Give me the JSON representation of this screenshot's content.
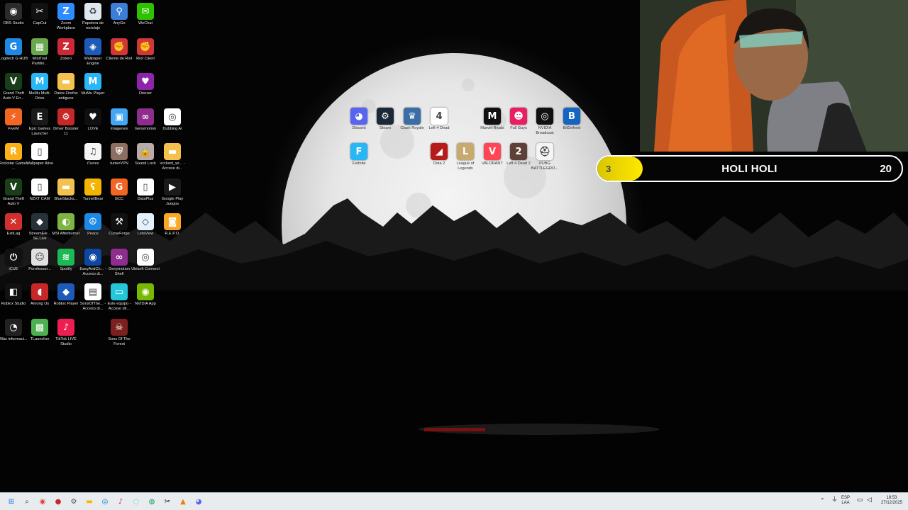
{
  "desktop": {
    "left_icons": [
      {
        "label": "OBS Studio",
        "icon": "obs-icon",
        "color": "#2b2b2b",
        "glyph": "◉"
      },
      {
        "label": "CapCut",
        "icon": "capcut-icon",
        "color": "#111111",
        "glyph": "✂"
      },
      {
        "label": "Zoom Workplace",
        "icon": "zoom-icon",
        "color": "#2d8cff",
        "glyph": "Z"
      },
      {
        "label": "Papelera de reciclaje",
        "icon": "recycle-bin-icon",
        "color": "#dfe8ef",
        "glyph": "♻"
      },
      {
        "label": "AnyGo",
        "icon": "anygo-icon",
        "color": "#3b7dd8",
        "glyph": "⚲"
      },
      {
        "label": "WeChat",
        "icon": "wechat-icon",
        "color": "#2dc100",
        "glyph": "✉"
      },
      {
        "label": "Logitech G HUB",
        "icon": "ghub-icon",
        "color": "#1e88e5",
        "glyph": "G"
      },
      {
        "label": "MiniTool Partitio...",
        "icon": "minitool-icon",
        "color": "#6aa84f",
        "glyph": "▦"
      },
      {
        "label": "Zotero",
        "icon": "zotero-icon",
        "color": "#cc2936",
        "glyph": "Z"
      },
      {
        "label": "Wallpaper Engine",
        "icon": "wallpaper-engine-icon",
        "color": "#1e5bb8",
        "glyph": "◈"
      },
      {
        "label": "Cliente de Riot",
        "icon": "riot-client-icon",
        "color": "#d13639",
        "glyph": "✊"
      },
      {
        "label": "Riot Client",
        "icon": "riot-icon",
        "color": "#d13639",
        "glyph": "✊"
      },
      {
        "label": "Grand Theft Auto V En...",
        "icon": "gta-enhanced-icon",
        "color": "#1a3d1a",
        "glyph": "V"
      },
      {
        "label": "MuMu Multi-Drive",
        "icon": "mumu-multi-icon",
        "color": "#29b6f6",
        "glyph": "M"
      },
      {
        "label": "Datos Firefox antiguos",
        "icon": "folder-icon",
        "color": "#f2c14e",
        "glyph": "▬"
      },
      {
        "label": "MuMu Player",
        "icon": "mumu-player-icon",
        "color": "#29b6f6",
        "glyph": "M"
      },
      {
        "label": "Deezer",
        "icon": "deezer-icon",
        "color": "#8e24aa",
        "glyph": "♥"
      },
      {
        "label": "FiveM",
        "icon": "fivem-icon",
        "color": "#f26522",
        "glyph": "⚡"
      },
      {
        "label": "Epic Games Launcher",
        "icon": "epic-games-icon",
        "color": "#1a1a1a",
        "glyph": "E"
      },
      {
        "label": "Driver Booster 11",
        "icon": "driver-booster-icon",
        "color": "#c62828",
        "glyph": "⚙"
      },
      {
        "label": "LOVE",
        "icon": "love-icon",
        "color": "#101010",
        "glyph": "♥"
      },
      {
        "label": "Imágenes",
        "icon": "images-icon",
        "color": "#42a5f5",
        "glyph": "▣"
      },
      {
        "label": "Genymotion",
        "icon": "genymotion-icon",
        "color": "#8e2d8e",
        "glyph": "∞"
      },
      {
        "label": "Dubbing AI",
        "icon": "dubbing-ai-icon",
        "color": "#ffffff",
        "glyph": "◎"
      },
      {
        "label": "Rockstar Games ...",
        "icon": "rockstar-icon",
        "color": "#fcaf17",
        "glyph": "R"
      },
      {
        "label": "Wallpaper Alive",
        "icon": "wallpaper-alive-icon",
        "color": "#ffffff",
        "glyph": "▯"
      },
      {
        "label": "iTunes",
        "icon": "itunes-icon",
        "color": "#f5f5f5",
        "glyph": "♫"
      },
      {
        "label": "tunlerVPN",
        "icon": "vpn-icon",
        "color": "#8d6e63",
        "glyph": "⛨"
      },
      {
        "label": "Sound Lock",
        "icon": "sound-lock-icon",
        "color": "#bcaaa4",
        "glyph": "🔒"
      },
      {
        "label": "vcclient_wi... - Acceso di...",
        "icon": "folder-shortcut-icon",
        "color": "#f2c14e",
        "glyph": "▬"
      },
      {
        "label": "Grand Theft Auto V",
        "icon": "gta-icon",
        "color": "#1a3d1a",
        "glyph": "V"
      },
      {
        "label": "NZXT CAM",
        "icon": "nzxt-icon",
        "color": "#ffffff",
        "glyph": "▯"
      },
      {
        "label": "BlueStacks...",
        "icon": "bluestacks-folder-icon",
        "color": "#f2c14e",
        "glyph": "▬"
      },
      {
        "label": "TunnelBear",
        "icon": "tunnelbear-icon",
        "color": "#f4b400",
        "glyph": "ʕ"
      },
      {
        "label": "GCC",
        "icon": "gcc-icon",
        "color": "#f26522",
        "glyph": "G"
      },
      {
        "label": "DataPlus",
        "icon": "dataplus-icon",
        "color": "#ffffff",
        "glyph": "▯"
      },
      {
        "label": "Google Play Juegos",
        "icon": "google-play-games-icon",
        "color": "#1a1a1a",
        "glyph": "▶"
      },
      {
        "label": "ExitLag",
        "icon": "exitlag-icon",
        "color": "#d32f2f",
        "glyph": "✕"
      },
      {
        "label": "StreamEle... SE.Live",
        "icon": "streamelements-icon",
        "color": "#263238",
        "glyph": "◆"
      },
      {
        "label": "MSI Afterburner",
        "icon": "msi-afterburner-icon",
        "color": "#7cb342",
        "glyph": "◐"
      },
      {
        "label": "Peace",
        "icon": "peace-icon",
        "color": "#1e88e5",
        "glyph": "☮"
      },
      {
        "label": "CurseForge",
        "icon": "curseforge-icon",
        "color": "#111111",
        "glyph": "⚒"
      },
      {
        "label": "LetsView",
        "icon": "letsview-icon",
        "color": "#e3f2fd",
        "glyph": "◇"
      },
      {
        "label": "R.E.P.O.",
        "icon": "repo-icon",
        "color": "#f9a825",
        "glyph": "◙"
      },
      {
        "label": "iCUE",
        "icon": "icue-icon",
        "color": "#111111",
        "glyph": "⏻"
      },
      {
        "label": "Porofessor...",
        "icon": "porofessor-icon",
        "color": "#e0e0e0",
        "glyph": "☺"
      },
      {
        "label": "Spotify",
        "icon": "spotify-icon",
        "color": "#1db954",
        "glyph": "≋"
      },
      {
        "label": "EasyAntiCh... - Acceso di...",
        "icon": "easyanticheat-icon",
        "color": "#0d47a1",
        "glyph": "◉"
      },
      {
        "label": "Genymotion Shell",
        "icon": "genymotion-shell-icon",
        "color": "#8e2d8e",
        "glyph": "∞"
      },
      {
        "label": "Ubisoft Connect",
        "icon": "ubisoft-icon",
        "color": "#ffffff",
        "glyph": "◎"
      },
      {
        "label": "Roblox Studio",
        "icon": "roblox-studio-icon",
        "color": "#111111",
        "glyph": "◧"
      },
      {
        "label": "Among Us",
        "icon": "among-us-icon",
        "color": "#c62828",
        "glyph": "◖"
      },
      {
        "label": "Roblox Player",
        "icon": "roblox-player-icon",
        "color": "#1e5bb8",
        "glyph": "◆"
      },
      {
        "label": "SonsOfThe... - Acceso di...",
        "icon": "sons-shortcut-icon",
        "color": "#ffffff",
        "glyph": "▤"
      },
      {
        "label": "Este equipo - Acceso dir...",
        "icon": "this-pc-icon",
        "color": "#26c6da",
        "glyph": "▭"
      },
      {
        "label": "NVIDIA App",
        "icon": "nvidia-app-icon",
        "color": "#76b900",
        "glyph": "◉"
      },
      {
        "label": "Más informaci...",
        "icon": "more-info-icon",
        "color": "#222222",
        "glyph": "◔"
      },
      {
        "label": "TLauncher",
        "icon": "tlauncher-icon",
        "color": "#4caf50",
        "glyph": "▩"
      },
      {
        "label": "TikTok LIVE Studio",
        "icon": "tiktok-live-icon",
        "color": "#ee1d52",
        "glyph": "♪"
      },
      {
        "label": "Sons Of The Forest",
        "icon": "sons-of-the-forest-icon",
        "color": "#7b1f1f",
        "glyph": "☠"
      }
    ],
    "center_icons": [
      {
        "label": "Discord",
        "icon": "discord-icon",
        "color": "#5865f2",
        "glyph": "◕"
      },
      {
        "label": "Steam",
        "icon": "steam-icon",
        "color": "#1b2838",
        "glyph": "⚙"
      },
      {
        "label": "Clash Royale",
        "icon": "clash-royale-icon",
        "color": "#3a6ea5",
        "glyph": "♛"
      },
      {
        "label": "Left 4 Dead",
        "icon": "left4dead-icon",
        "color": "#ffffff",
        "glyph": "4"
      },
      {
        "label": "Marvel Rivals",
        "icon": "marvel-rivals-icon",
        "color": "#111111",
        "glyph": "M"
      },
      {
        "label": "Fall Guys",
        "icon": "fall-guys-icon",
        "color": "#e91e63",
        "glyph": "☻"
      },
      {
        "label": "NVIDIA Broadcast",
        "icon": "nvidia-broadcast-icon",
        "color": "#111111",
        "glyph": "◎"
      },
      {
        "label": "BitDefend",
        "icon": "bitdefender-icon",
        "color": "#1565c0",
        "glyph": "B"
      },
      {
        "label": "Fortnite",
        "icon": "fortnite-icon",
        "color": "#29b6f6",
        "glyph": "F"
      },
      {
        "label": "Dota 2",
        "icon": "dota2-icon",
        "color": "#b71c1c",
        "glyph": "◢"
      },
      {
        "label": "League of Legends",
        "icon": "lol-icon",
        "color": "#c8aa6e",
        "glyph": "L"
      },
      {
        "label": "VALORANT",
        "icon": "valorant-icon",
        "color": "#ff4655",
        "glyph": "V"
      },
      {
        "label": "Left 4 Dead 2",
        "icon": "left4dead2-icon",
        "color": "#5d4037",
        "glyph": "2"
      },
      {
        "label": "PUBG BATTLEGRO...",
        "icon": "pubg-icon",
        "color": "#f5f5f5",
        "glyph": "⛑"
      }
    ]
  },
  "goal": {
    "title": "HOLI HOLI",
    "current": "3",
    "target": "20",
    "progress_fraction": 0.15,
    "fill_color": "#ffe800"
  },
  "taskbar": {
    "apps": [
      {
        "icon": "start-icon",
        "glyph": "⊞",
        "color": "#1a73e8"
      },
      {
        "icon": "search-icon",
        "glyph": "⌕",
        "color": "#333333"
      },
      {
        "icon": "chrome-icon",
        "glyph": "◉",
        "color": "#db4437"
      },
      {
        "icon": "settings-icon",
        "glyph": "⚙",
        "color": "#555555"
      },
      {
        "icon": "obs-taskbar-icon",
        "glyph": "●",
        "color": "#c62828"
      },
      {
        "icon": "file-explorer-icon",
        "glyph": "▬",
        "color": "#f2b705"
      },
      {
        "icon": "edge-icon",
        "glyph": "◎",
        "color": "#0078d4"
      },
      {
        "icon": "tiktok-taskbar-icon",
        "glyph": "♪",
        "color": "#ee1d52"
      },
      {
        "icon": "whatsapp-icon",
        "glyph": "◌",
        "color": "#25d366"
      },
      {
        "icon": "browser-icon",
        "glyph": "◍",
        "color": "#0f9d58"
      },
      {
        "icon": "capcut-taskbar-icon",
        "glyph": "✂",
        "color": "#111111"
      },
      {
        "icon": "aimp-icon",
        "glyph": "▲",
        "color": "#f57c00"
      },
      {
        "icon": "discord-taskbar-icon",
        "glyph": "◕",
        "color": "#5865f2"
      }
    ],
    "tray": {
      "lang_top": "ESP",
      "lang_bottom": "LAA",
      "time": "18:53",
      "date": "27/12/2025"
    }
  }
}
